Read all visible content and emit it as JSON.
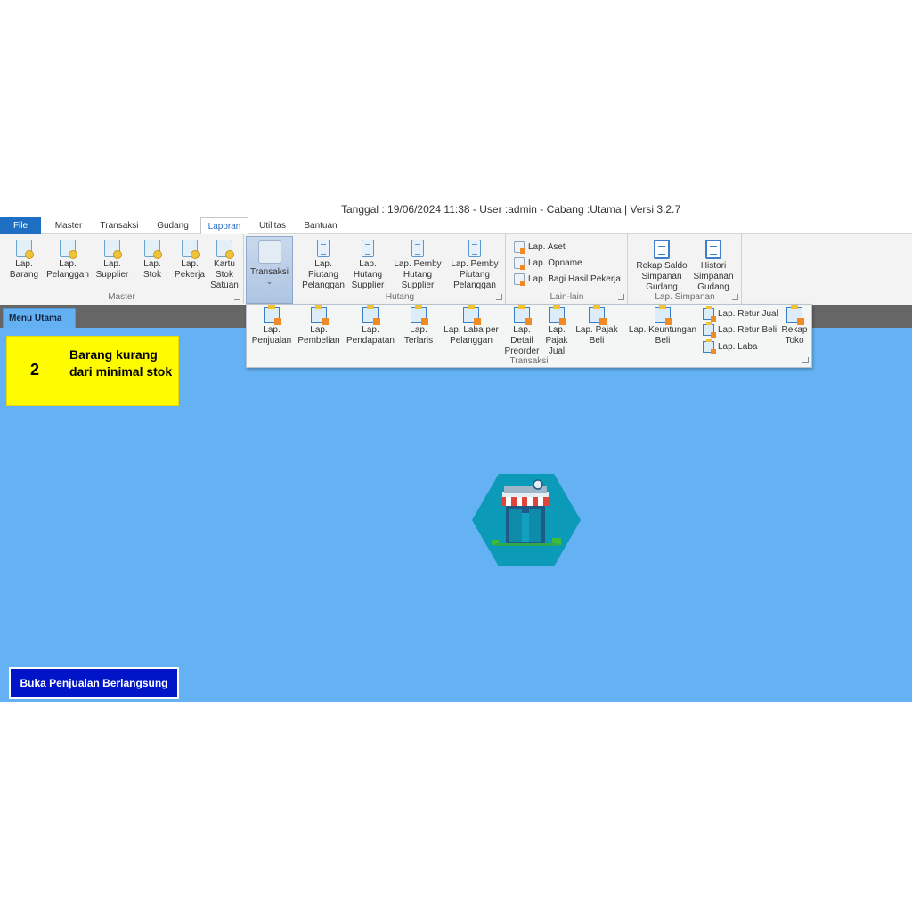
{
  "window": {
    "title": "Tanggal : 19/06/2024 11:38 - User :admin - Cabang :Utama | Versi 3.2.7"
  },
  "tabs": [
    {
      "label": "File",
      "active": false
    },
    {
      "label": "Master",
      "active": false
    },
    {
      "label": "Transaksi",
      "active": false
    },
    {
      "label": "Gudang",
      "active": false
    },
    {
      "label": "Laporan",
      "active": true
    },
    {
      "label": "Utilitas",
      "active": false
    },
    {
      "label": "Bantuan",
      "active": false
    }
  ],
  "ribbon": {
    "master": {
      "label": "Master",
      "buttons": [
        {
          "label": "Lap. Barang",
          "icon": "report-doc-icon"
        },
        {
          "label": "Lap. Pelanggan",
          "icon": "report-doc-icon"
        },
        {
          "label": "Lap. Supplier",
          "icon": "report-doc-icon"
        },
        {
          "label": "Lap. Stok",
          "icon": "report-doc-icon"
        },
        {
          "label": "Lap. Pekerja",
          "icon": "report-doc-icon"
        },
        {
          "label": "Kartu Stok Satuan",
          "icon": "report-doc-icon"
        }
      ]
    },
    "transaksi": {
      "label": "Transaksi",
      "chevron": "⌄"
    },
    "hutang": {
      "label": "Hutang",
      "buttons": [
        {
          "label": "Lap. Piutang Pelanggan",
          "icon": "clipboard-icon"
        },
        {
          "label": "Lap. Hutang Supplier",
          "icon": "clipboard-icon"
        },
        {
          "label": "Lap. Pemby Hutang Supplier",
          "icon": "clipboard-icon"
        },
        {
          "label": "Lap. Pemby Piutang Pelanggan",
          "icon": "clipboard-icon"
        }
      ]
    },
    "lain_lain": {
      "label": "Lain-lain",
      "buttons": [
        {
          "label": "Lap. Aset",
          "icon": "mini-report-icon"
        },
        {
          "label": "Lap. Opname",
          "icon": "mini-report-icon"
        },
        {
          "label": "Lap. Bagi Hasil Pekerja",
          "icon": "mini-report-icon"
        }
      ]
    },
    "simpanan": {
      "label": "Lap. Simpanan",
      "buttons": [
        {
          "label": "Rekap Saldo Simpanan Gudang",
          "icon": "page-icon"
        },
        {
          "label": "Histori Simpanan Gudang",
          "icon": "page-icon"
        }
      ]
    }
  },
  "dropdown": {
    "label": "Transaksi",
    "buttons": [
      {
        "label": "Lap. Penjualan"
      },
      {
        "label": "Lap. Pembelian"
      },
      {
        "label": "Lap. Pendapatan"
      },
      {
        "label": "Lap. Terlaris"
      },
      {
        "label": "Lap. Laba per Pelanggan"
      },
      {
        "label": "Lap. Detail Preorder"
      },
      {
        "label": "Lap. Pajak Jual"
      },
      {
        "label": "Lap. Pajak Beli"
      },
      {
        "label": "Lap. Keuntungan Beli"
      }
    ],
    "small_buttons": [
      {
        "label": "Lap. Retur Jual"
      },
      {
        "label": "Lap. Retur Beli"
      },
      {
        "label": "Lap. Laba"
      }
    ],
    "rekap": {
      "label": "Rekap Toko"
    }
  },
  "document_tab": {
    "label": "Menu Utama"
  },
  "notification": {
    "count": "2",
    "message": "Barang kurang dari minimal stok",
    "color": "#fffb00"
  },
  "open_sale_button": {
    "label": "Buka Penjualan Berlangsung",
    "color": "#0014c8"
  },
  "colors": {
    "accent": "#1e6fc4",
    "workspace": "#64b2f4"
  }
}
